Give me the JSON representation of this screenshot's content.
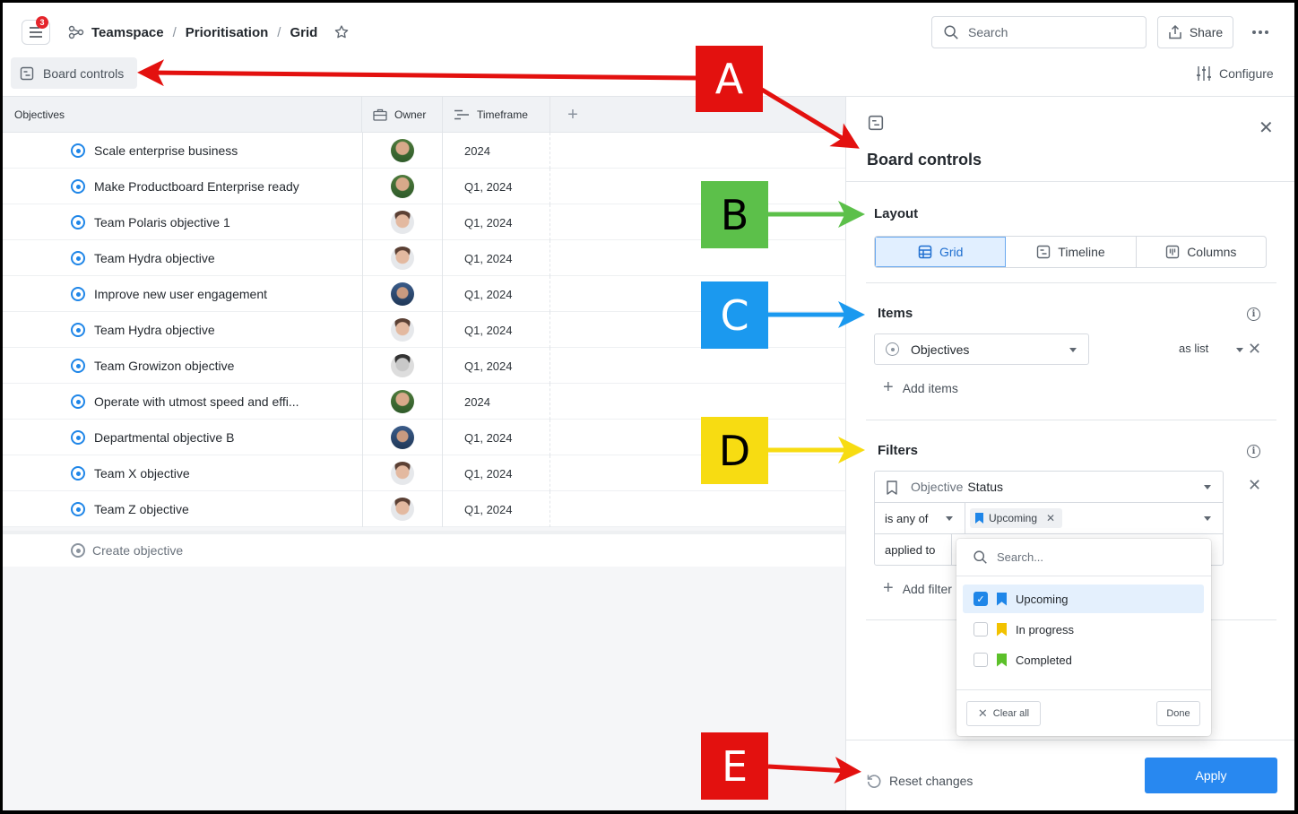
{
  "header": {
    "notification_count": "3",
    "breadcrumbs": [
      "Teamspace",
      "Prioritisation",
      "Grid"
    ],
    "search_placeholder": "Search",
    "share_label": "Share",
    "board_controls_label": "Board controls",
    "configure_label": "Configure"
  },
  "grid": {
    "columns": [
      "Objectives",
      "Owner",
      "Timeframe"
    ],
    "rows": [
      {
        "name": "Scale enterprise business",
        "timeframe": "2024",
        "avatar": "green"
      },
      {
        "name": "Make Productboard Enterprise ready",
        "timeframe": "Q1, 2024",
        "avatar": "green"
      },
      {
        "name": "Team Polaris objective 1",
        "timeframe": "Q1, 2024",
        "avatar": "light"
      },
      {
        "name": "Team Hydra objective",
        "timeframe": "Q1, 2024",
        "avatar": "light"
      },
      {
        "name": "Improve new user engagement",
        "timeframe": "Q1, 2024",
        "avatar": "dark"
      },
      {
        "name": "Team Hydra objective",
        "timeframe": "Q1, 2024",
        "avatar": "light"
      },
      {
        "name": "Team Growizon objective",
        "timeframe": "Q1, 2024",
        "avatar": "gray"
      },
      {
        "name": "Operate with utmost speed and effi...",
        "timeframe": "2024",
        "avatar": "green"
      },
      {
        "name": "Departmental objective B",
        "timeframe": "Q1, 2024",
        "avatar": "dark"
      },
      {
        "name": "Team X objective",
        "timeframe": "Q1, 2024",
        "avatar": "light"
      },
      {
        "name": "Team Z objective",
        "timeframe": "Q1, 2024",
        "avatar": "light"
      }
    ],
    "create_label": "Create objective"
  },
  "panel": {
    "title": "Board controls",
    "layout": {
      "label": "Layout",
      "options": [
        "Grid",
        "Timeline",
        "Columns"
      ],
      "selected": "Grid"
    },
    "items": {
      "label": "Items",
      "entity": "Objectives",
      "display": "as list",
      "add_label": "Add items"
    },
    "filters": {
      "label": "Filters",
      "field_prefix": "Objective",
      "field": "Status",
      "operator": "is any of",
      "chip": "Upcoming",
      "applied_label": "applied to",
      "add_label": "Add filter"
    },
    "reset_label": "Reset changes",
    "apply_label": "Apply"
  },
  "dropdown": {
    "search_placeholder": "Search...",
    "options": [
      {
        "label": "Upcoming",
        "checked": true,
        "color": "#1f86e8"
      },
      {
        "label": "In progress",
        "checked": false,
        "color": "#f2c200"
      },
      {
        "label": "Completed",
        "checked": false,
        "color": "#5cc02a"
      }
    ],
    "clear_label": "Clear all",
    "done_label": "Done"
  },
  "annotations": {
    "a": "A",
    "b": "B",
    "c": "C",
    "d": "D",
    "e": "E",
    "colors": {
      "a": "#e3110f",
      "b": "#5cc04a",
      "c": "#1b99ef",
      "d": "#f7dc12",
      "e": "#e3110f"
    }
  }
}
